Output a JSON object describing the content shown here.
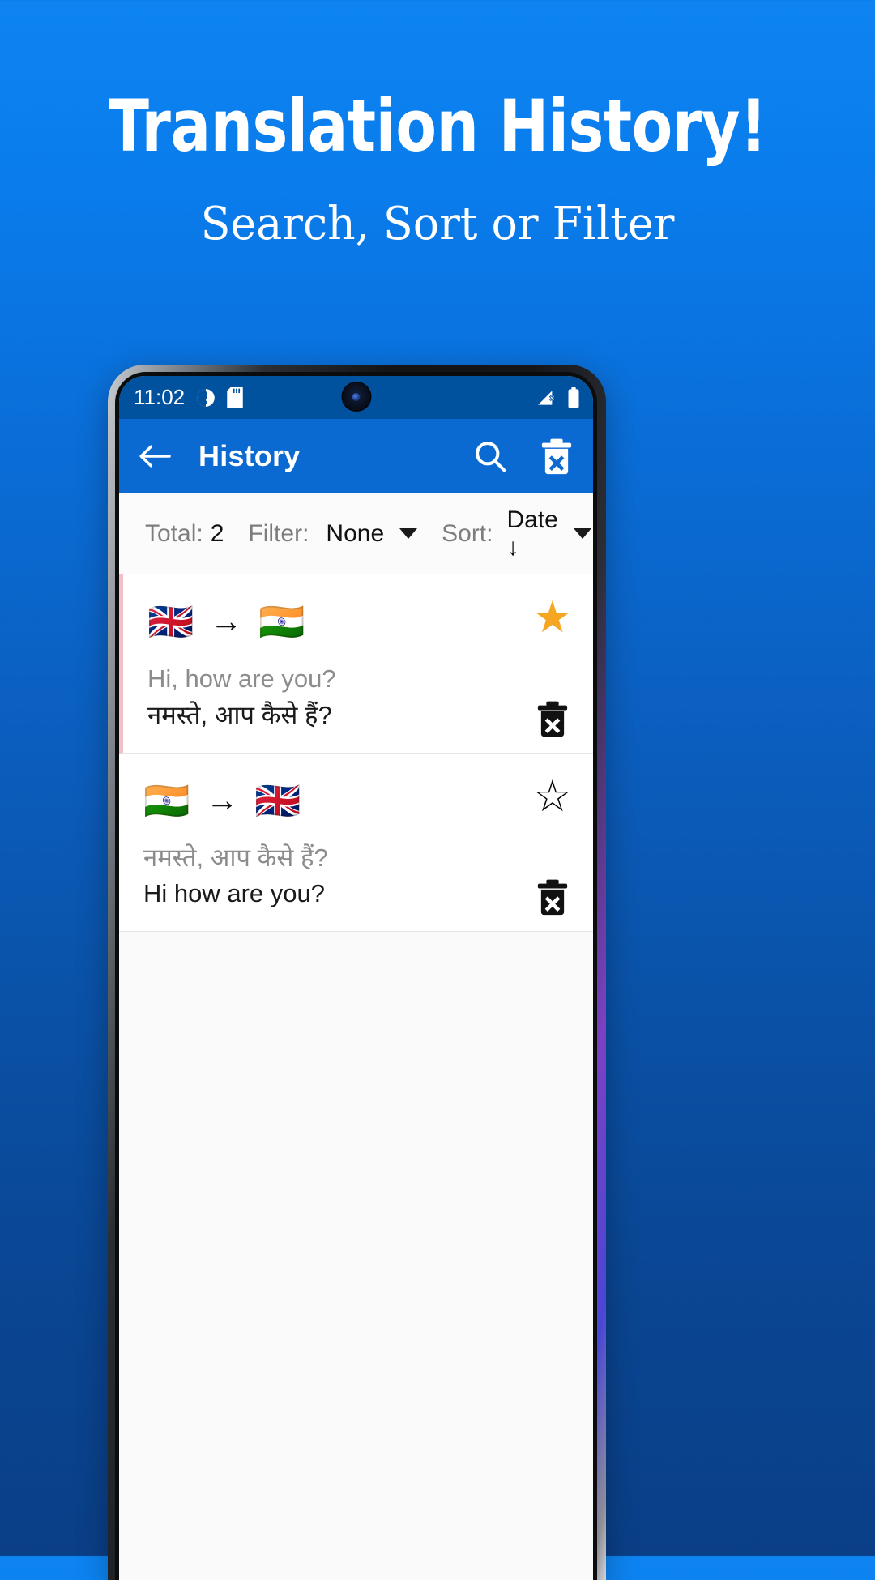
{
  "promo": {
    "title": "Translation History!",
    "subtitle": "Search, Sort or Filter"
  },
  "colors": {
    "background_top": "#0d84f2",
    "background_bottom": "#0a3f87",
    "appbar": "#0b6ad2",
    "statusbar": "#00519e",
    "star_active": "#f5a623"
  },
  "phone": {
    "statusbar": {
      "time": "11:02",
      "icons_left": [
        "do-not-disturb-icon",
        "sd-card-icon"
      ],
      "icons_right": [
        "no-signal-icon",
        "battery-icon"
      ],
      "camera": "front-camera-punchhole"
    },
    "appbar": {
      "back_icon": "arrow-left-icon",
      "title": "History",
      "search_icon": "search-icon",
      "delete_all_icon": "delete-all-icon"
    },
    "filterbar": {
      "total_label": "Total:",
      "total_value": "2",
      "filter_label": "Filter:",
      "filter_value": "None",
      "sort_label": "Sort:",
      "sort_value": "Date ↓"
    },
    "history": [
      {
        "source_flag": "🇬🇧",
        "target_flag": "🇮🇳",
        "arrow": "→",
        "source_text": "Hi, how are you?",
        "target_text": "नमस्ते, आप कैसे हैं?",
        "favorite": true,
        "star_glyph": "★",
        "delete_icon": "delete-item-icon"
      },
      {
        "source_flag": "🇮🇳",
        "target_flag": "🇬🇧",
        "arrow": "→",
        "source_text": "नमस्ते, आप कैसे हैं?",
        "target_text": "Hi how are you?",
        "favorite": false,
        "star_glyph": "☆",
        "delete_icon": "delete-item-icon"
      }
    ]
  }
}
